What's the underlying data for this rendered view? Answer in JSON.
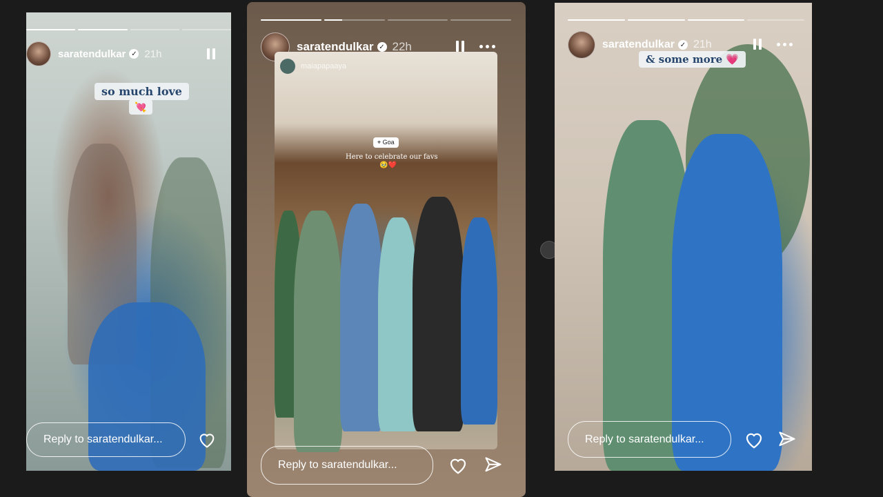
{
  "stories": [
    {
      "username": "saratendulkar",
      "time": "21h",
      "sticker_text": "so much love",
      "sticker_emoji": "💘",
      "reply_placeholder": "Reply to saratendulkar...",
      "progress": [
        1,
        1,
        0,
        0,
        0
      ]
    },
    {
      "username": "saratendulkar",
      "time": "22h",
      "reposted_user": "maiapapaaya",
      "location": "Goa",
      "caption": "Here to celebrate our favs",
      "caption_emoji": "🥹❤️",
      "reply_placeholder": "Reply to saratendulkar...",
      "progress": [
        1,
        0.3,
        0,
        0,
        0,
        0
      ]
    },
    {
      "username": "saratendulkar",
      "time": "21h",
      "sticker_text": "& some more",
      "sticker_emoji": "💗",
      "reply_placeholder": "Reply to saratendulkar...",
      "progress": [
        1,
        1,
        1,
        0,
        0
      ]
    }
  ],
  "colors": {
    "background": "#1b1b1b",
    "sticker_text": "#27466d"
  },
  "icons": [
    "verified-badge-icon",
    "pause-icon",
    "more-options-icon",
    "heart-icon",
    "send-icon"
  ]
}
